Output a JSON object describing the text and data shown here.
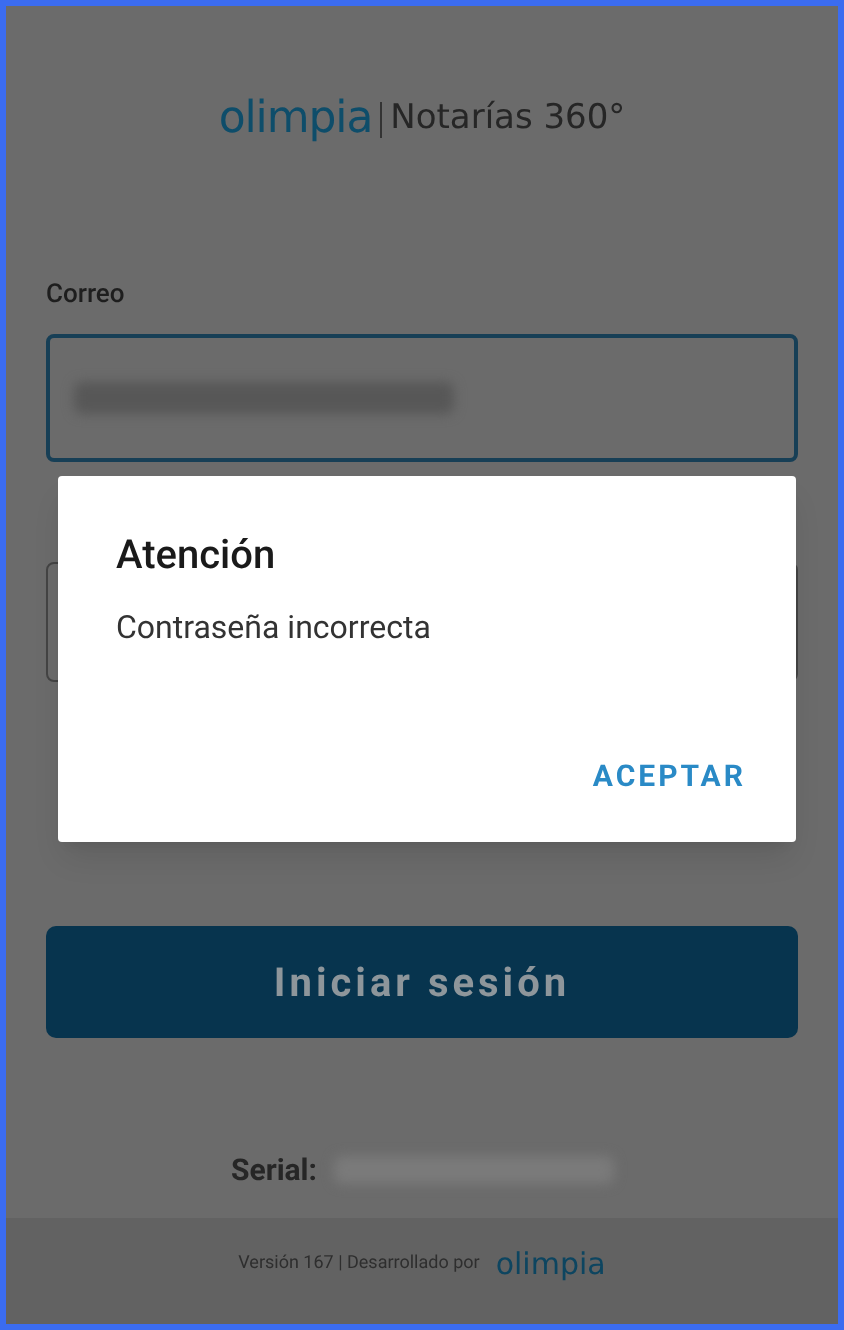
{
  "header": {
    "logo": "olimpia",
    "product": "Notarías 360°"
  },
  "form": {
    "email_label": "Correo",
    "submit": "Iniciar sesión",
    "serial_label": "Serial:"
  },
  "footer": {
    "version": "Versión 167 | Desarrollado por",
    "logo": "olimpia"
  },
  "dialog": {
    "title": "Atención",
    "message": "Contraseña incorrecta",
    "button": "ACEPTAR"
  }
}
